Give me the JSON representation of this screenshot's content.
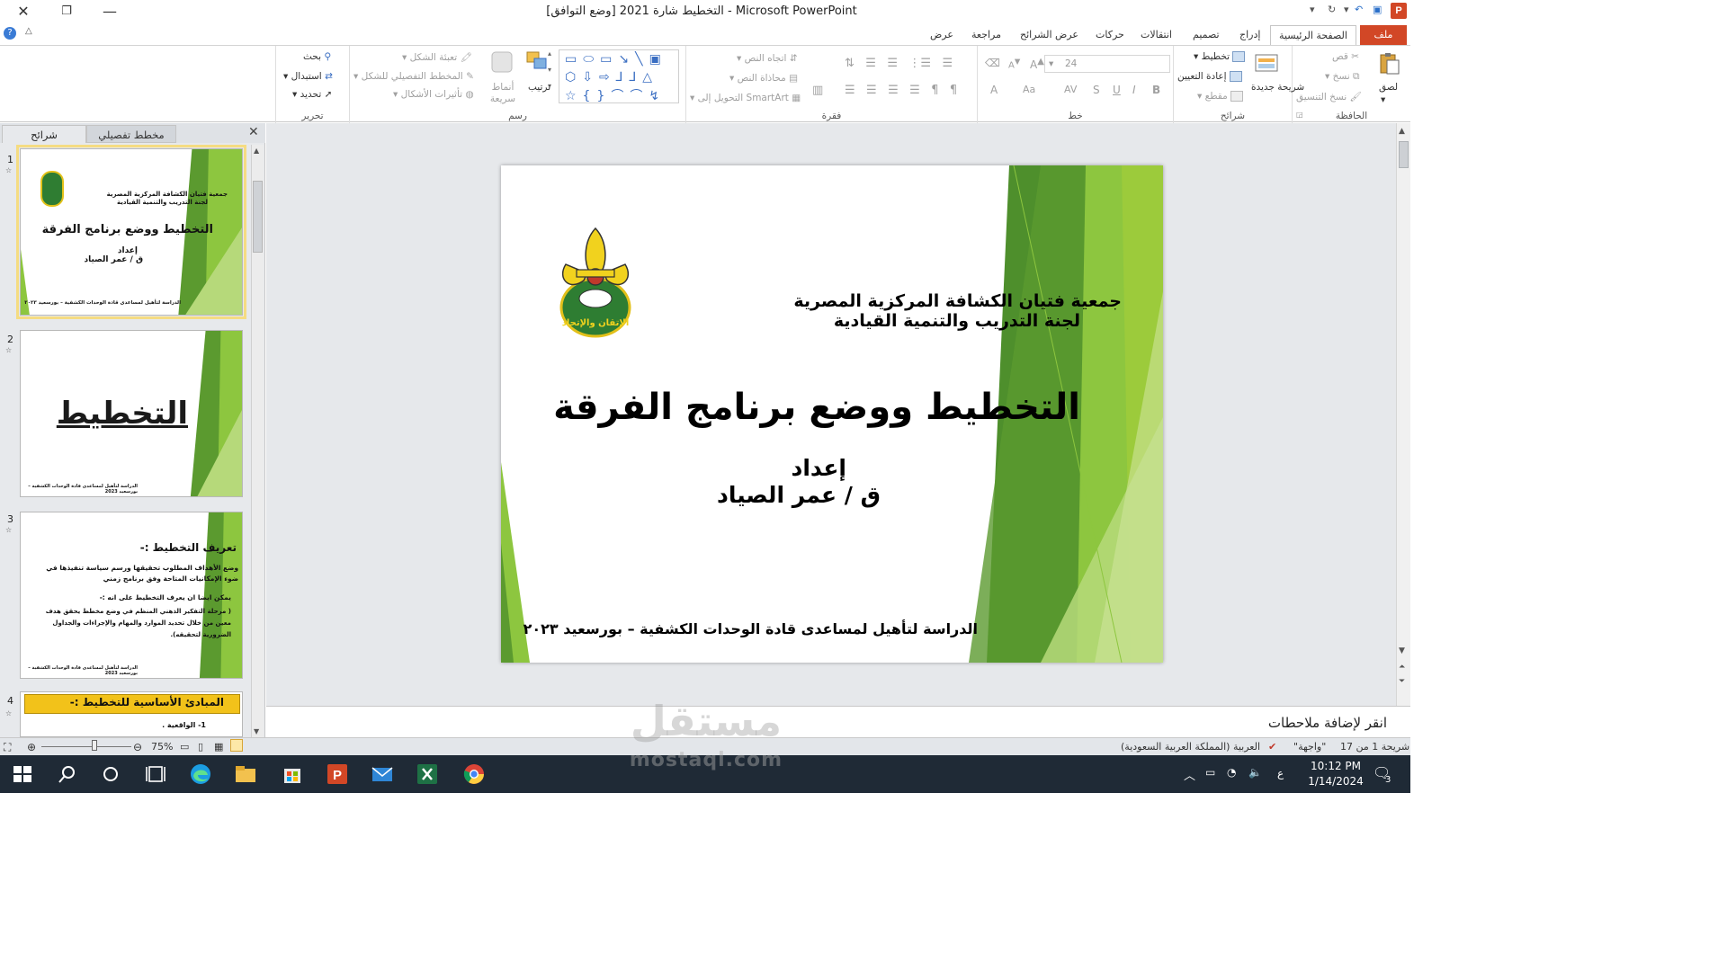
{
  "window": {
    "title": "التخطيط شارة 2021 [وضع التوافق] - Microsoft PowerPoint",
    "app_badge": "P"
  },
  "tabs": [
    {
      "label": "ملف"
    },
    {
      "label": "الصفحة الرئيسية"
    },
    {
      "label": "إدراج"
    },
    {
      "label": "تصميم"
    },
    {
      "label": "انتقالات"
    },
    {
      "label": "حركات"
    },
    {
      "label": "عرض الشرائح"
    },
    {
      "label": "مراجعة"
    },
    {
      "label": "عرض"
    }
  ],
  "ribbon": {
    "clipboard": {
      "label": "الحافظة",
      "paste": "لصق",
      "cut": "قص",
      "copy": "نسخ",
      "format_painter": "نسخ التنسيق"
    },
    "slides": {
      "label": "شرائح",
      "new_slide": "شريحة جديدة",
      "layout": "تخطيط",
      "reset": "إعادة التعيين",
      "section": "مقطع"
    },
    "font": {
      "label": "خط",
      "size": "24",
      "bold": "B",
      "italic": "I",
      "underline": "U",
      "strike": "S",
      "spacing": "AV",
      "case": "Aa",
      "color": "A",
      "grow": "A",
      "shrink": "A"
    },
    "paragraph": {
      "label": "فقرة",
      "text_direction": "اتجاه النص",
      "align_text": "محاذاة النص",
      "smartart": "التحويل إلى SmartArt"
    },
    "drawing": {
      "label": "رسم",
      "arrange": "ترتيب",
      "quick_styles": "أنماط سريعة",
      "shape_fill": "تعبئة الشكل",
      "shape_outline": "المخطط التفصيلي للشكل",
      "shape_effects": "تأثيرات الأشكال"
    },
    "editing": {
      "label": "تحرير",
      "find": "بحث",
      "replace": "استبدال",
      "select": "تحديد"
    }
  },
  "left_panel": {
    "tab_slides": "شرائح",
    "tab_outline": "مخطط تفصيلي",
    "thumbnails": [
      {
        "num": "1",
        "org": "جمعية فتيان الكشافة المركزية المصرية",
        "committee": "لجنة التدريب والتنمية القيادية",
        "title": "التخطيط ووضع برنامج الفرقة",
        "prep": "إعداد",
        "author": "ق / عمر الصياد",
        "footer": "الدراسة لتأهيل لمساعدى قادة الوحدات الكشفية – بورسعيد ٢٠٢٣"
      },
      {
        "num": "2",
        "title": "التخطيط",
        "footer": "الدراسة لتأهيل لمساعدى قادة الوحدات الكشفية – بورسعيد 2023"
      },
      {
        "num": "3",
        "heading": "تعريف التخطيط :-",
        "line1": "وضع الأهداف المطلوب تحقيقها ورسم سياسة تنفيذها في ضوء الإمكانيات المتاحة وفق برنامج زمني",
        "line2": "يمكن ايضا ان يعرف التخطيط على انه :-",
        "line3": "( مرحلة التفكير الذهني المنظم في وضع مخطط يحقق هدف معين من خلال تحديد الموارد والمهام والإجراءات والجداول الضرورية لتحقيقه).",
        "footer": "الدراسة لتأهيل لمساعدى قادة الوحدات الكشفية – بورسعيد 2023"
      },
      {
        "num": "4",
        "heading": "المبادئ الأساسية للتخطيط :-",
        "item1": "1- الواقعية ."
      }
    ]
  },
  "slide": {
    "org": "جمعية فتيان الكشافة المركزية المصرية",
    "committee": "لجنة التدريب والتنمية القيادية",
    "title": "التخطيط ووضع برنامج الفرقة",
    "prep": "إعداد",
    "author": "ق / عمر الصياد",
    "footer": "الدراسة لتأهيل لمساعدى قادة الوحدات الكشفية – بورسعيد ٢٠٢٣",
    "logo_text": "الإتقان والإتحاد"
  },
  "notes": {
    "placeholder": "انقر لإضافة ملاحطات"
  },
  "status": {
    "slide_info": "شريحة 1 من 17",
    "theme": "\"واجهة\"",
    "language": "العربية (المملكة العربية السعودية)",
    "zoom": "75%"
  },
  "taskbar": {
    "time": "10:12 PM",
    "date": "1/14/2024",
    "input_lang": "ع",
    "notif_count": "3"
  },
  "watermark": {
    "arabic": "مستقل",
    "latin": "mostaql.com"
  },
  "colors": {
    "accent": "#d24726",
    "green_dark": "#4e8f2c",
    "green_light": "#9ccb3b",
    "selection": "#f5dc82"
  }
}
